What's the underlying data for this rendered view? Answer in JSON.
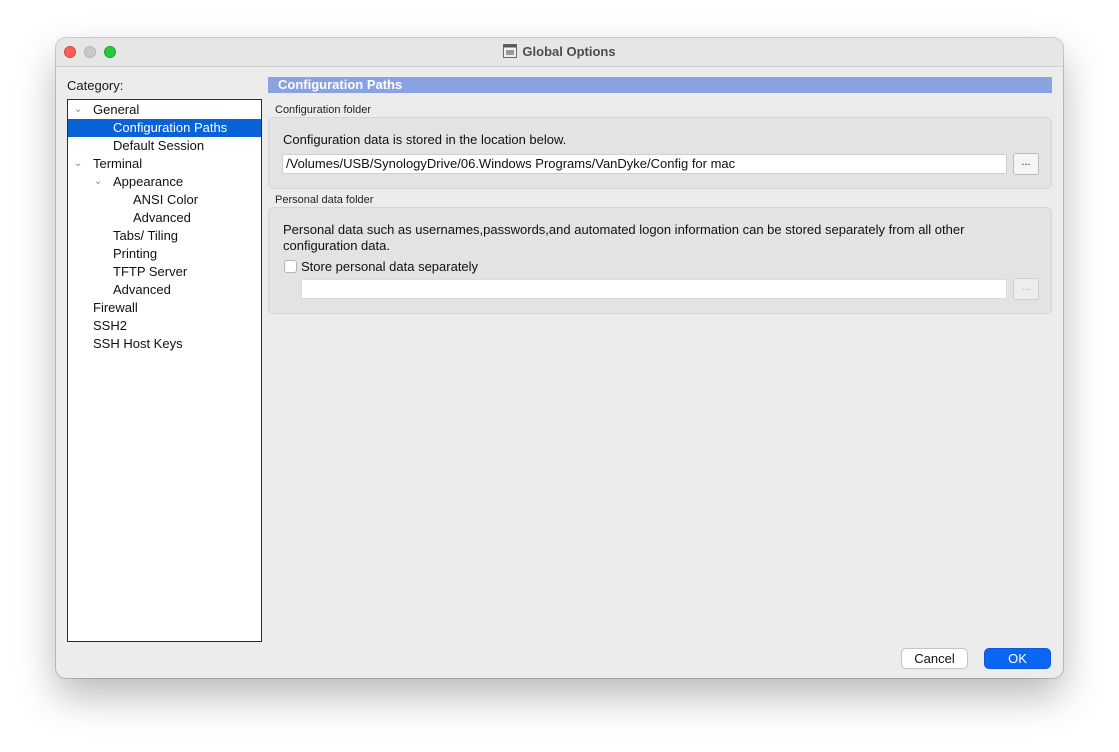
{
  "window": {
    "title": "Global Options"
  },
  "sidebar": {
    "category_label": "Category:",
    "items": [
      {
        "label": "General",
        "expanded": true
      },
      {
        "label": "Configuration Paths",
        "selected": true
      },
      {
        "label": "Default Session"
      },
      {
        "label": "Terminal",
        "expanded": true
      },
      {
        "label": "Appearance",
        "expanded": true
      },
      {
        "label": "ANSI Color"
      },
      {
        "label": "Advanced"
      },
      {
        "label": "Tabs/ Tiling"
      },
      {
        "label": "Printing"
      },
      {
        "label": "TFTP Server"
      },
      {
        "label": "Advanced"
      },
      {
        "label": "Firewall"
      },
      {
        "label": "SSH2"
      },
      {
        "label": "SSH Host Keys"
      }
    ]
  },
  "panel": {
    "header": "Configuration Paths",
    "config_folder": {
      "group_title": "Configuration folder",
      "description": "Configuration data is stored in the location below.",
      "path_value": "/Volumes/USB/SynologyDrive/06.Windows Programs/VanDyke/Config for mac",
      "browse_label": "..."
    },
    "personal_folder": {
      "group_title": "Personal data folder",
      "description_line1": "Personal data such as usernames,passwords,and automated logon information can be stored separately from all other",
      "description_line2": "configuration data.",
      "checkbox_label": "Store personal data separately",
      "checkbox_checked": false,
      "path_value": "",
      "browse_label": "..."
    }
  },
  "footer": {
    "cancel_label": "Cancel",
    "ok_label": "OK"
  },
  "colors": {
    "selection": "#0a63d6",
    "header_bar": "#8aa2e1",
    "ok_button": "#0a66f5"
  },
  "icons": {
    "chevron": "chevron-down-icon",
    "app": "app-icon"
  }
}
